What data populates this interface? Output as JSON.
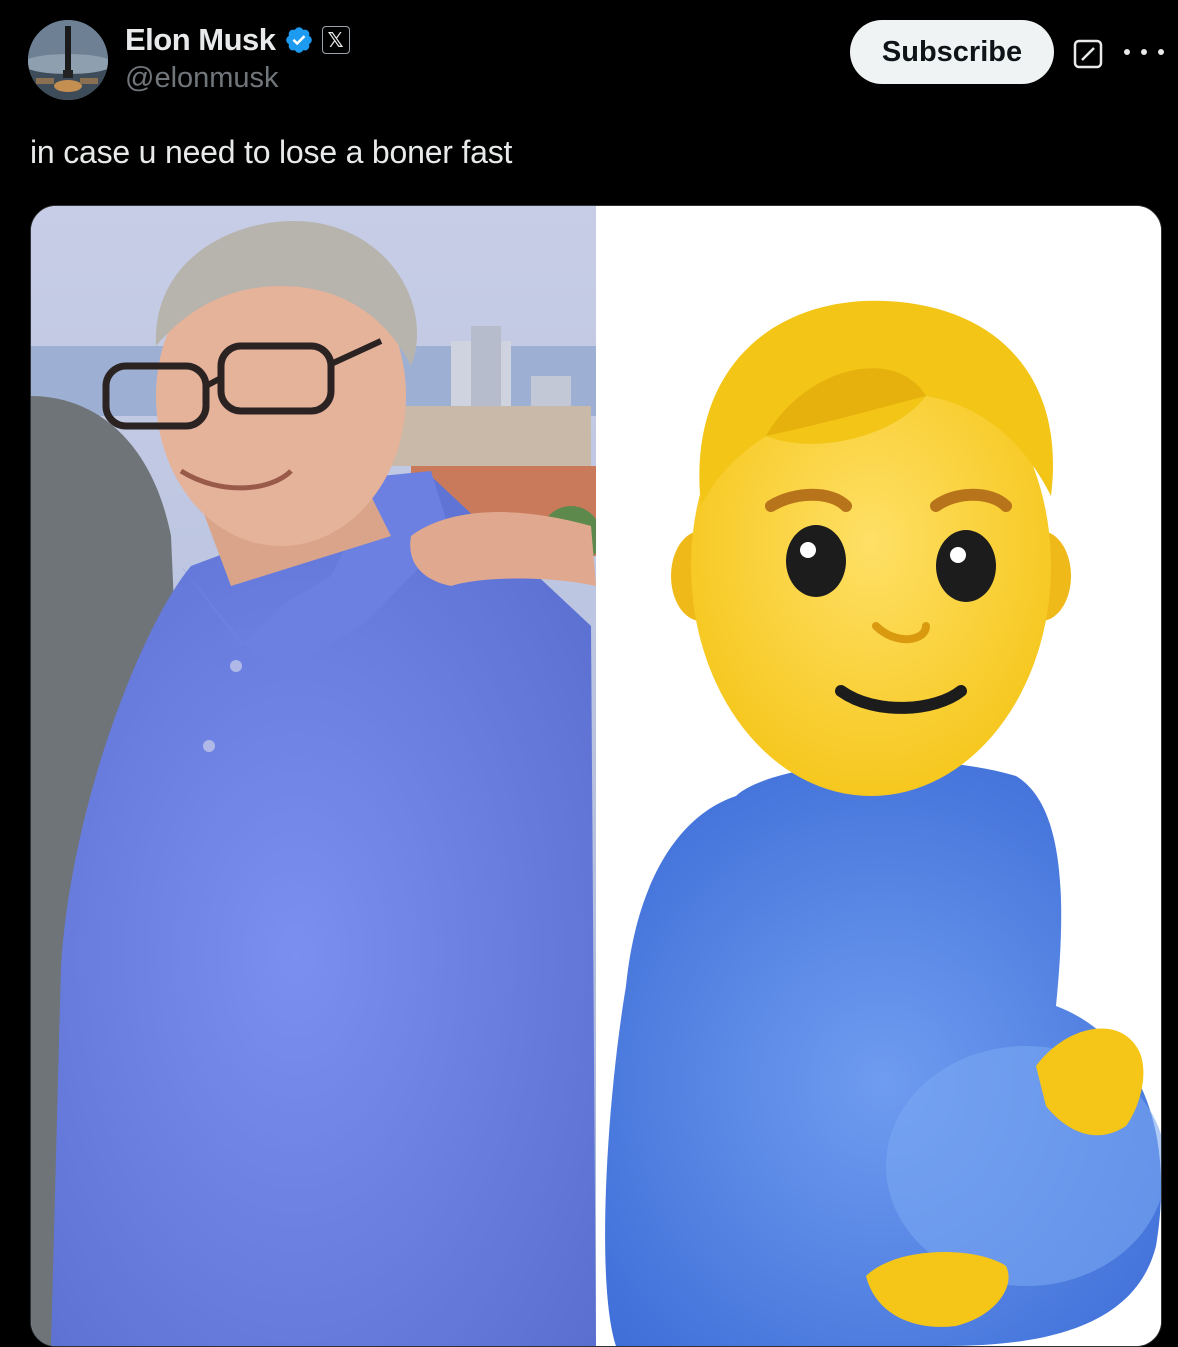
{
  "author": {
    "name": "Elon Musk",
    "handle": "@elonmusk",
    "verified": true,
    "affiliation_badge": "𝕏",
    "avatar_icon": "rocket-launch-avatar"
  },
  "actions": {
    "subscribe_label": "Subscribe",
    "grok_icon": "grok-icon",
    "more_icon": "more-icon"
  },
  "tweet": {
    "text": "in case u need to lose a boner fast"
  },
  "media": {
    "panels": [
      {
        "description_icon": "photo-man-blue-polo"
      },
      {
        "description_icon": "pregnant-man-emoji"
      }
    ]
  },
  "colors": {
    "background": "#000000",
    "text": "#e7e9ea",
    "secondary_text": "#71767b",
    "verified_blue": "#1d9bf0",
    "subscribe_bg": "#eff3f4"
  }
}
